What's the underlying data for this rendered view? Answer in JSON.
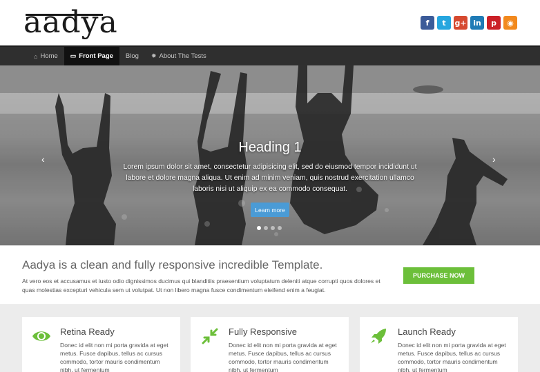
{
  "header": {
    "logo_text": "aadya",
    "social": [
      {
        "icon": "facebook-icon",
        "glyph": "f",
        "color": "#3b5b99"
      },
      {
        "icon": "twitter-icon",
        "glyph": "t",
        "color": "#26a6df"
      },
      {
        "icon": "google-plus-icon",
        "glyph": "g+",
        "color": "#d6492f"
      },
      {
        "icon": "linkedin-icon",
        "glyph": "in",
        "color": "#1f7bb6"
      },
      {
        "icon": "pinterest-icon",
        "glyph": "p",
        "color": "#cb2027"
      },
      {
        "icon": "rss-icon",
        "glyph": "◉",
        "color": "#f2891d"
      }
    ]
  },
  "nav": {
    "items": [
      {
        "label": "Home",
        "icon": "home-icon",
        "glyph": "⌂"
      },
      {
        "label": "Front Page",
        "icon": "monitor-icon",
        "glyph": "▭",
        "active": true
      },
      {
        "label": "Blog",
        "icon": "",
        "glyph": ""
      },
      {
        "label": "About The Tests",
        "icon": "gear-icon",
        "glyph": "✹"
      }
    ]
  },
  "slider": {
    "heading": "Heading 1",
    "text": "Lorem ipsum dolor sit amet, consectetur adipisicing elit, sed do eiusmod tempor incididunt ut labore et dolore magna aliqua. Ut enim ad minim veniam, quis nostrud exercitation ullamco laboris nisi ut aliquip ex ea commodo consequat.",
    "button_label": "Learn more",
    "prev_glyph": "‹",
    "next_glyph": "›"
  },
  "intro": {
    "title": "Aadya is a clean and fully responsive incredible Template.",
    "text": "At vero eos et accusamus et iusto odio dignissimos ducimus qui blanditiis praesentium voluptatum deleniti atque corrupti quos dolores et quas molestias excepturi vehicula sem ut volutpat. Ut non libero magna fusce condimentum eleifend enim a feugiat.",
    "button_label": "PURCHASE NOW",
    "accent_color": "#6cbf3a"
  },
  "features": [
    {
      "title": "Retina Ready",
      "icon": "eye-icon",
      "text": "Donec id elit non mi porta gravida at eget metus. Fusce dapibus, tellus ac cursus commodo, tortor mauris condimentum nibh, ut fermentum"
    },
    {
      "title": "Fully Responsive",
      "icon": "arrows-in-icon",
      "text": "Donec id elit non mi porta gravida at eget metus. Fusce dapibus, tellus ac cursus commodo, tortor mauris condimentum nibh, ut fermentum"
    },
    {
      "title": "Launch Ready",
      "icon": "rocket-icon",
      "text": "Donec id elit non mi porta gravida at eget metus. Fusce dapibus, tellus ac cursus commodo, tortor mauris condimentum nibh, ut fermentum"
    }
  ]
}
